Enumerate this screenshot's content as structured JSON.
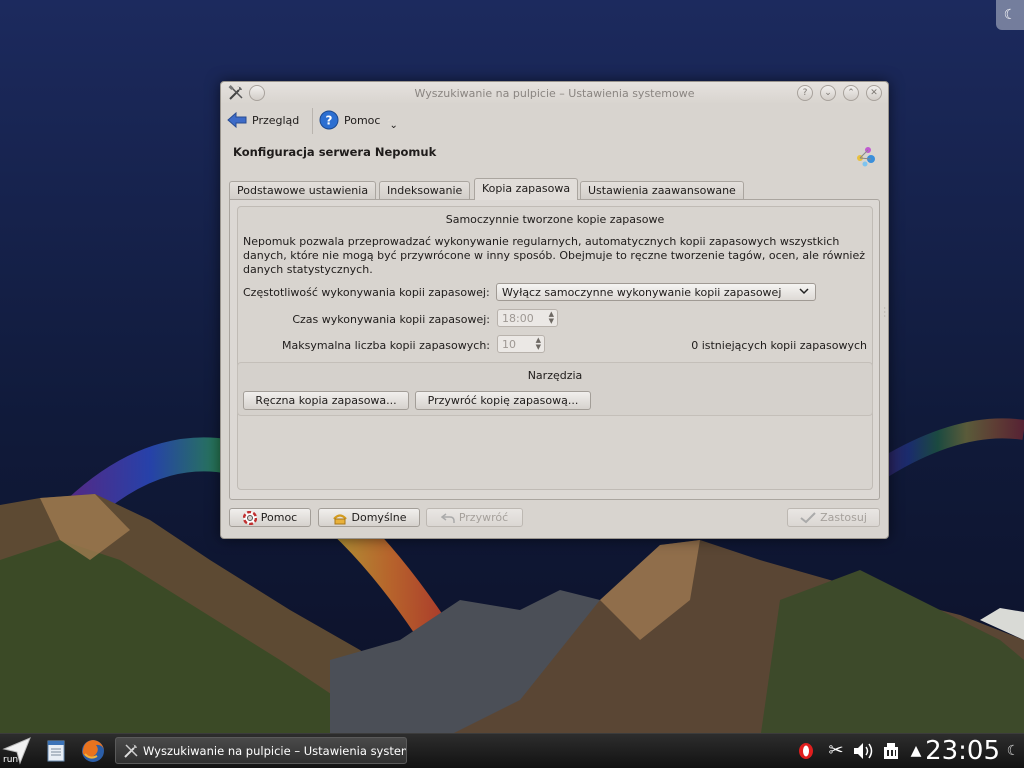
{
  "window": {
    "title": "Wyszukiwanie na pulpicie – Ustawienia systemowe",
    "help_glyph": "?",
    "minimize_glyph": "⌄",
    "maximize_glyph": "⌃",
    "close_glyph": "✕"
  },
  "toolbar": {
    "back_label": "Przegląd",
    "help_label": "Pomoc",
    "help_dropdown_glyph": "⌄"
  },
  "page": {
    "title": "Konfiguracja serwera Nepomuk"
  },
  "tabs": [
    {
      "label": "Podstawowe ustawienia",
      "active": false
    },
    {
      "label": "Indeksowanie",
      "active": false
    },
    {
      "label": "Kopia zapasowa",
      "active": true
    },
    {
      "label": "Ustawienia zaawansowane",
      "active": false
    }
  ],
  "backup": {
    "group_title": "Samoczynnie tworzone kopie zapasowe",
    "description": "Nepomuk pozwala przeprowadzać wykonywanie regularnych, automatycznych kopii zapasowych wszystkich danych, które nie mogą być przywrócone w inny sposób. Obejmuje to ręczne tworzenie tagów, ocen, ale również danych statystycznych.",
    "frequency_label": "Częstotliwość wykonywania kopii zapasowej:",
    "frequency_value": "Wyłącz samoczynne wykonywanie kopii zapasowej",
    "time_label": "Czas wykonywania kopii zapasowej:",
    "time_value": "18:00",
    "max_label": "Maksymalna liczba kopii zapasowych:",
    "max_value": "10",
    "existing_count": "0 istniejących kopii zapasowych"
  },
  "tools": {
    "title": "Narzędzia",
    "manual_backup": "Ręczna kopia zapasowa...",
    "restore_backup": "Przywróć kopię zapasową..."
  },
  "dialog_buttons": {
    "help": "Pomoc",
    "defaults": "Domyślne",
    "reset": "Przywróć",
    "apply": "Zastosuj"
  },
  "taskbar": {
    "launcher_label": "run",
    "task_title": "Wyszukiwanie na pulpicie – Ustawienia system",
    "clock": "23:05"
  },
  "colors": {
    "window_bg": "#d8d4cf",
    "taskbar_bg": "#1a1a1a",
    "sky": "#1b2a5c"
  }
}
